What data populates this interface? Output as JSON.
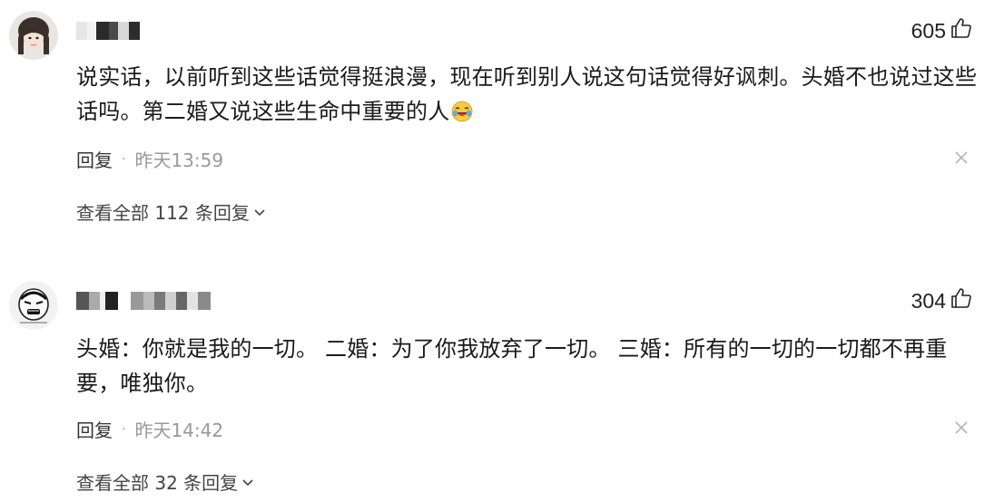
{
  "comments": [
    {
      "likes": "605",
      "text": "说实话，以前听到这些话觉得挺浪漫，现在听到别人说这句话觉得好讽刺。头婚不也说过这些话吗。第二婚又说这些生命中重要的人",
      "emoji": "laughing-crying-emoji",
      "reply_label": "回复",
      "time": "昨天13:59",
      "view_all": "查看全部 112 条回复"
    },
    {
      "likes": "304",
      "text": "头婚：你就是我的一切。 二婚：为了你我放弃了一切。 三婚：所有的一切的一切都不再重要，唯独你。",
      "reply_label": "回复",
      "time": "昨天14:42",
      "view_all": "查看全部 32 条回复"
    }
  ],
  "icons": {
    "like": "thumbs-up-icon",
    "close": "close-icon",
    "expand": "chevron-down-icon"
  },
  "colors": {
    "text": "#1a1a1a",
    "meta": "#999999"
  }
}
